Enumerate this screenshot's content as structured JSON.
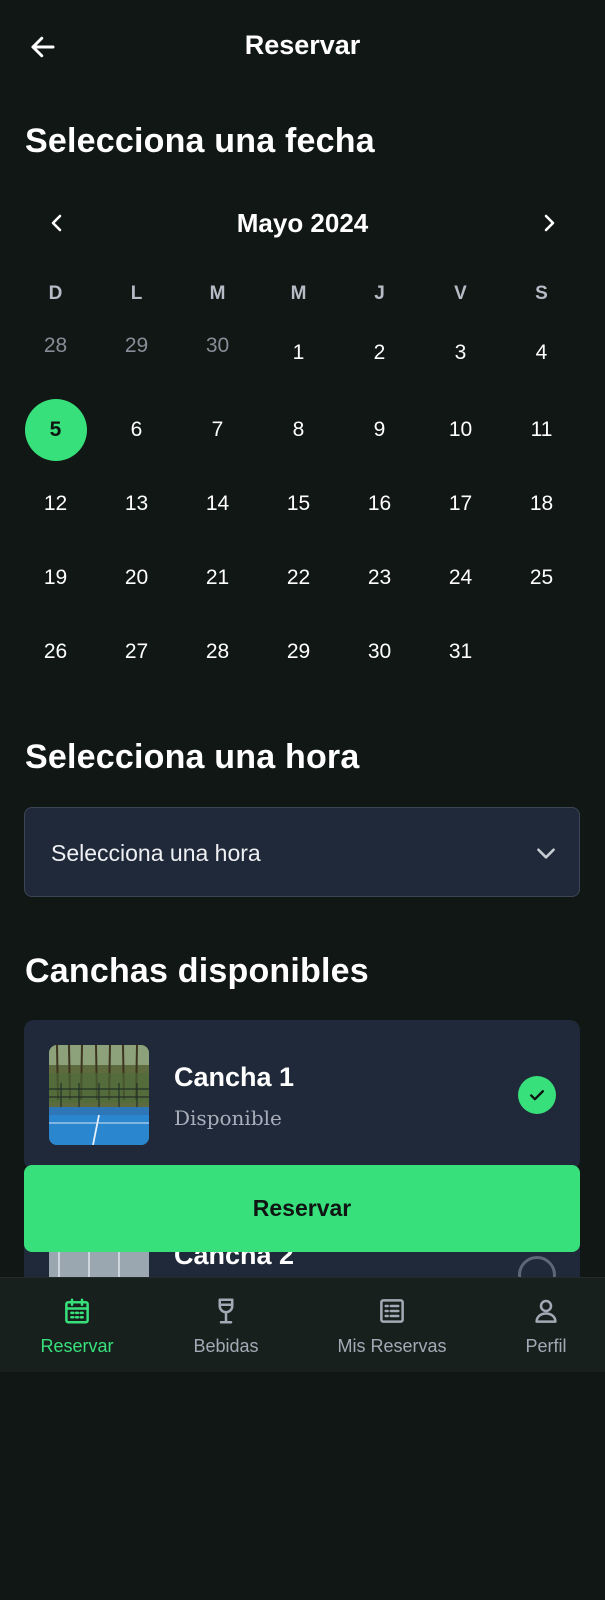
{
  "header": {
    "title": "Reservar",
    "back_icon": "arrow-left-icon"
  },
  "date_section": {
    "title": "Selecciona una fecha"
  },
  "calendar": {
    "month_label": "Mayo 2024",
    "weekdays": [
      "D",
      "L",
      "M",
      "M",
      "J",
      "V",
      "S"
    ],
    "selected_day": "5",
    "weeks": [
      [
        {
          "d": "28",
          "m": true
        },
        {
          "d": "29",
          "m": true
        },
        {
          "d": "30",
          "m": true
        },
        {
          "d": "1"
        },
        {
          "d": "2"
        },
        {
          "d": "3"
        },
        {
          "d": "4"
        }
      ],
      [
        {
          "d": "5",
          "s": true
        },
        {
          "d": "6"
        },
        {
          "d": "7"
        },
        {
          "d": "8"
        },
        {
          "d": "9"
        },
        {
          "d": "10"
        },
        {
          "d": "11"
        }
      ],
      [
        {
          "d": "12"
        },
        {
          "d": "13"
        },
        {
          "d": "14"
        },
        {
          "d": "15"
        },
        {
          "d": "16"
        },
        {
          "d": "17"
        },
        {
          "d": "18"
        }
      ],
      [
        {
          "d": "19"
        },
        {
          "d": "20"
        },
        {
          "d": "21"
        },
        {
          "d": "22"
        },
        {
          "d": "23"
        },
        {
          "d": "24"
        },
        {
          "d": "25"
        }
      ],
      [
        {
          "d": "26"
        },
        {
          "d": "27"
        },
        {
          "d": "28"
        },
        {
          "d": "29"
        },
        {
          "d": "30"
        },
        {
          "d": "31"
        },
        {
          "d": ""
        }
      ]
    ]
  },
  "time_section": {
    "title": "Selecciona una hora",
    "select_value": "Selecciona una hora"
  },
  "courts_section": {
    "title": "Canchas disponibles",
    "courts": [
      {
        "name": "Cancha 1",
        "status": "Disponible",
        "selected": true
      },
      {
        "name": "Cancha 2",
        "status": "",
        "selected": false
      }
    ]
  },
  "reserve_button": {
    "label": "Reservar"
  },
  "bottom_nav": {
    "items": [
      {
        "label": "Reservar",
        "icon": "calendar-icon",
        "active": true
      },
      {
        "label": "Bebidas",
        "icon": "wine-glass-icon",
        "active": false
      },
      {
        "label": "Mis Reservas",
        "icon": "list-icon",
        "active": false
      },
      {
        "label": "Perfil",
        "icon": "user-icon",
        "active": false
      }
    ]
  },
  "colors": {
    "accent": "#38e07b",
    "background": "#111715",
    "card": "#202939"
  }
}
